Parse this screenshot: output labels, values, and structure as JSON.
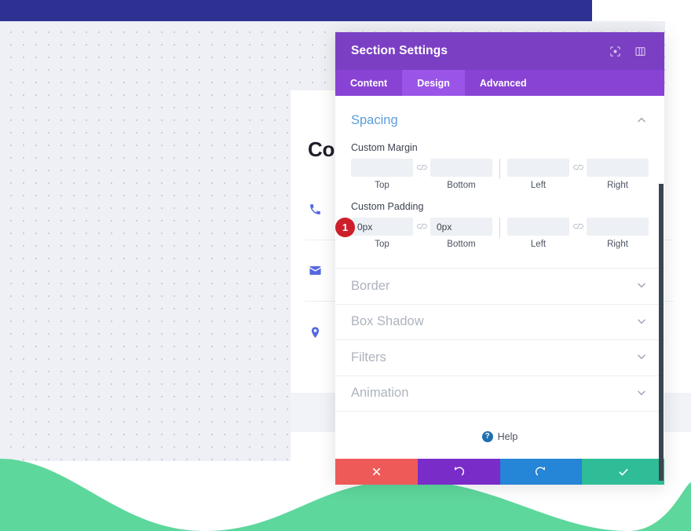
{
  "background": {
    "site_title": "Contact",
    "contact_items": [
      {
        "icon": "phone-icon"
      },
      {
        "icon": "envelope-icon"
      },
      {
        "icon": "map-pin-icon"
      }
    ],
    "colors": {
      "navy_bar": "#2e3192",
      "dot_grid": "#c9cede",
      "wave_green": "#5ed79d",
      "icon_blue": "#5468e0"
    }
  },
  "panel": {
    "title": "Section Settings",
    "header_icons": [
      {
        "name": "focus-target-icon"
      },
      {
        "name": "layout-columns-icon"
      }
    ],
    "tabs": [
      {
        "label": "Content",
        "active": false
      },
      {
        "label": "Design",
        "active": true
      },
      {
        "label": "Advanced",
        "active": false
      }
    ],
    "spacing": {
      "title": "Spacing",
      "collapse_state": "expanded",
      "margin": {
        "label": "Custom Margin",
        "fields": [
          {
            "caption": "Top",
            "value": "",
            "placeholder": ""
          },
          {
            "caption": "Bottom",
            "value": "",
            "placeholder": ""
          },
          {
            "caption": "Left",
            "value": "",
            "placeholder": ""
          },
          {
            "caption": "Right",
            "value": "",
            "placeholder": ""
          }
        ],
        "link_icon": "link-chain-icon"
      },
      "padding": {
        "label": "Custom Padding",
        "badge": "1",
        "badge_color": "#cc1f2b",
        "fields": [
          {
            "caption": "Top",
            "value": "0px",
            "placeholder": ""
          },
          {
            "caption": "Bottom",
            "value": "0px",
            "placeholder": ""
          },
          {
            "caption": "Left",
            "value": "",
            "placeholder": ""
          },
          {
            "caption": "Right",
            "value": "",
            "placeholder": ""
          }
        ],
        "link_icon": "link-chain-icon"
      }
    },
    "collapsed_sections": [
      {
        "title": "Border"
      },
      {
        "title": "Box Shadow"
      },
      {
        "title": "Filters"
      },
      {
        "title": "Animation"
      }
    ],
    "help": {
      "label": "Help",
      "icon": "question-mark-icon"
    },
    "footer_buttons": [
      {
        "name": "cancel-button",
        "icon": "close-x-icon",
        "color": "#ee5a58"
      },
      {
        "name": "undo-button",
        "icon": "undo-arrow-icon",
        "color": "#7a2cc9"
      },
      {
        "name": "redo-button",
        "icon": "redo-arrow-icon",
        "color": "#2585d6"
      },
      {
        "name": "save-button",
        "icon": "checkmark-icon",
        "color": "#2ebd96"
      }
    ]
  }
}
